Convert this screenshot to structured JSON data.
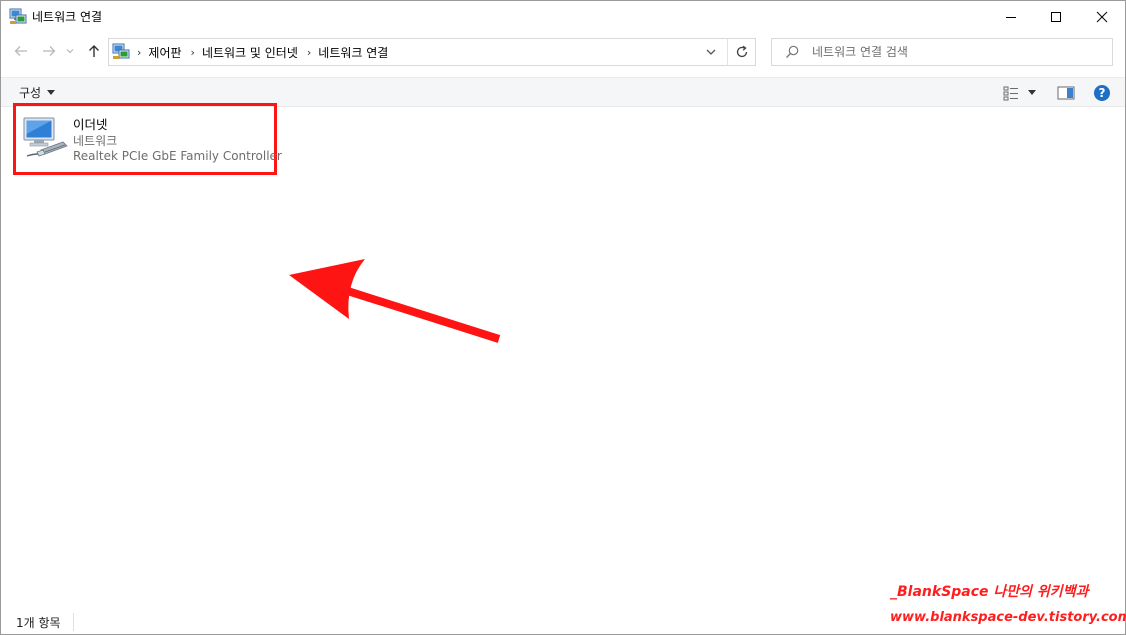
{
  "window": {
    "title": "네트워크 연결",
    "icon": "network-connections-icon"
  },
  "address": {
    "crumbs": [
      "제어판",
      "네트워크 및 인터넷",
      "네트워크 연결"
    ]
  },
  "search": {
    "placeholder": "네트워크 연결 검색"
  },
  "toolbar": {
    "organize_label": "구성"
  },
  "items": [
    {
      "name": "이더넷",
      "type": "네트워크",
      "device": "Realtek PCIe GbE Family Controller",
      "icon": "ethernet-adapter-icon"
    }
  ],
  "status": {
    "count": "1개 항목"
  },
  "watermark": {
    "line1": "_BlankSpace 나만의 위키백과",
    "line2": "www.blankspace-dev.tistory.com"
  },
  "colors": {
    "highlight": "#ff1414",
    "help": "#1f6fc5",
    "watermark": "#ff1e1e"
  }
}
